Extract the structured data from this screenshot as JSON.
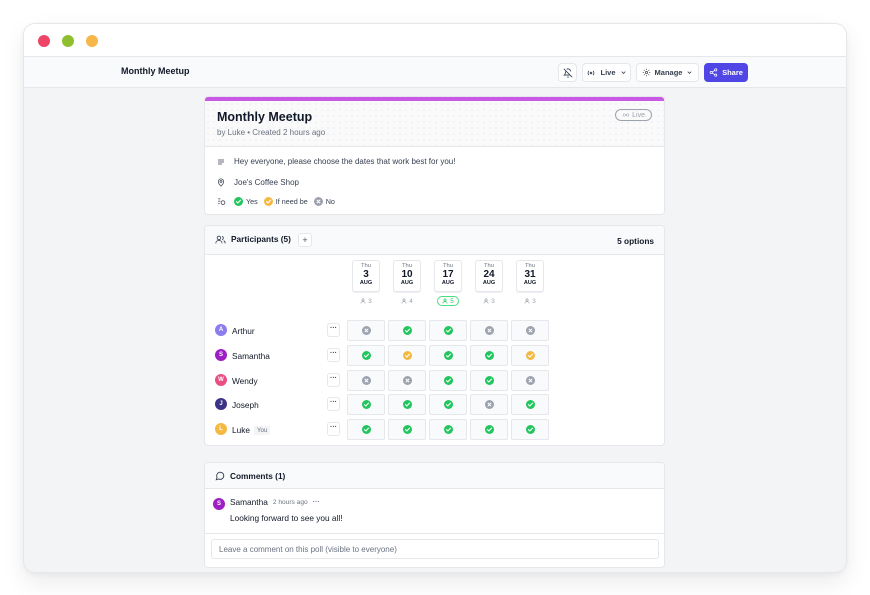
{
  "window": {
    "traffic_lights": {
      "close": "#ef4466",
      "minimize": "#8fbf2e",
      "zoom": "#f6b74b"
    }
  },
  "toolbar": {
    "app_title": "Monthly Meetup",
    "live_label": "Live",
    "manage_label": "Manage",
    "share_label": "Share",
    "accent_color": "#4f46e5"
  },
  "poll": {
    "title": "Monthly Meetup",
    "byline": "by Luke • Created 2 hours ago",
    "status_badge": "Live",
    "description": "Hey everyone, please choose the dates that work best for you!",
    "location": "Joe's Coffee Shop",
    "legend": {
      "yes": "Yes",
      "ifneedbe": "If need be",
      "no": "No"
    },
    "accent_color": "#c759e6"
  },
  "participants": {
    "title": "Participants (5)",
    "add_label": "+",
    "options_count": "5 options",
    "dates": [
      {
        "dow": "Thu",
        "day": "3",
        "month": "AUG",
        "count": "3",
        "best": false
      },
      {
        "dow": "Thu",
        "day": "10",
        "month": "AUG",
        "count": "4",
        "best": false
      },
      {
        "dow": "Thu",
        "day": "17",
        "month": "AUG",
        "count": "5",
        "best": true
      },
      {
        "dow": "Thu",
        "day": "24",
        "month": "AUG",
        "count": "3",
        "best": false
      },
      {
        "dow": "Thu",
        "day": "31",
        "month": "AUG",
        "count": "3",
        "best": false
      }
    ],
    "rows": [
      {
        "initial": "A",
        "name": "Arthur",
        "color": "#8b7cf0",
        "you": "",
        "votes": [
          "no",
          "yes",
          "yes",
          "no",
          "no"
        ]
      },
      {
        "initial": "S",
        "name": "Samantha",
        "color": "#9d1fc4",
        "you": "",
        "votes": [
          "yes",
          "ifneedbe",
          "yes",
          "yes",
          "ifneedbe"
        ]
      },
      {
        "initial": "W",
        "name": "Wendy",
        "color": "#e84f84",
        "you": "",
        "votes": [
          "no",
          "no",
          "yes",
          "yes",
          "no"
        ]
      },
      {
        "initial": "J",
        "name": "Joseph",
        "color": "#3b3486",
        "you": "",
        "votes": [
          "yes",
          "yes",
          "yes",
          "no",
          "yes"
        ]
      },
      {
        "initial": "L",
        "name": "Luke",
        "color": "#f5b942",
        "you": "You",
        "votes": [
          "yes",
          "yes",
          "yes",
          "yes",
          "yes"
        ]
      }
    ],
    "menu_label": "···"
  },
  "comments": {
    "title": "Comments (1)",
    "items": [
      {
        "initial": "S",
        "author": "Samantha",
        "time": "2 hours ago",
        "text": "Looking forward to see you all!",
        "color": "#9d1fc4",
        "menu": "···"
      }
    ],
    "input_placeholder": "Leave a comment on this poll (visible to everyone)"
  },
  "vote_colors": {
    "yes": "#22c55e",
    "ifneedbe": "#f5b942",
    "no": "#9ca3af"
  }
}
